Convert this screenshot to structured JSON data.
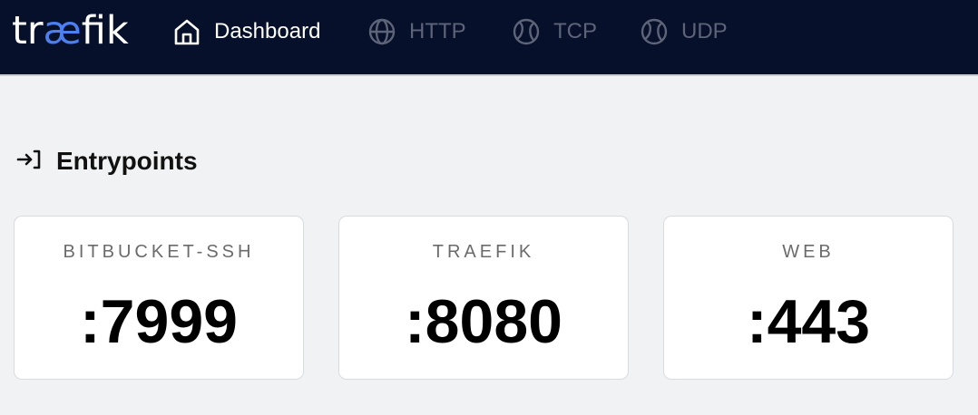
{
  "app": {
    "logo_prefix": "tr",
    "logo_accent": "æ",
    "logo_suffix": "fik"
  },
  "nav": [
    {
      "label": "Dashboard",
      "icon": "home-icon",
      "active": true
    },
    {
      "label": "HTTP",
      "icon": "globe-icon",
      "active": false
    },
    {
      "label": "TCP",
      "icon": "network-ball-icon",
      "active": false
    },
    {
      "label": "UDP",
      "icon": "network-ball-icon",
      "active": false
    }
  ],
  "section": {
    "title": "Entrypoints",
    "icon": "login-arrow-icon"
  },
  "entrypoints": [
    {
      "name": "BITBUCKET-SSH",
      "port": ":7999"
    },
    {
      "name": "TRAEFIK",
      "port": ":8080"
    },
    {
      "name": "WEB",
      "port": ":443"
    }
  ],
  "colors": {
    "topbar": "#06102a",
    "accent": "#4c7ff0",
    "background": "#f1f2f4",
    "inactive_nav": "#5d6478"
  }
}
